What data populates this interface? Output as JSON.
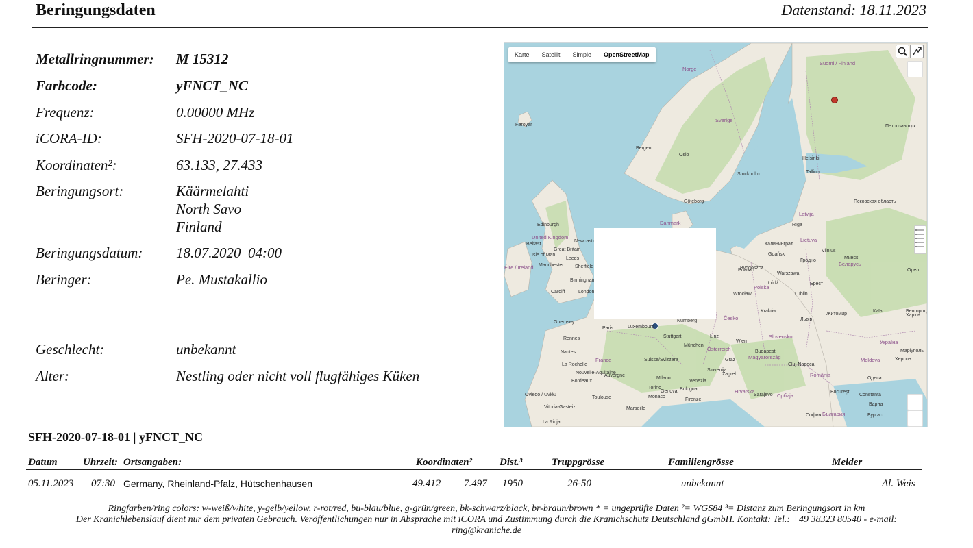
{
  "header": {
    "title": "Beringungsdaten",
    "data_date": "Datenstand: 18.11.2023"
  },
  "info": [
    {
      "label": "Metallringnummer:",
      "value": "M 15312",
      "bold": true
    },
    {
      "label": "Farbcode:",
      "value": "yFNCT_NC",
      "bold": true
    },
    {
      "label": "Frequenz:",
      "value": "0.00000 MHz"
    },
    {
      "label": "iCORA-ID:",
      "value": "SFH-2020-07-18-01"
    },
    {
      "label": "Koordinaten²:",
      "value": "63.133, 27.433"
    },
    {
      "label": "Beringungsort:",
      "value_lines": [
        "Käärmelahti",
        "North Savo",
        "Finland"
      ]
    },
    {
      "label": "Beringungsdatum:",
      "value": "18.07.2020  04:00"
    },
    {
      "label": "Beringer:",
      "value": "Pe. Mustakallio"
    },
    {
      "label": "Geschlecht:",
      "value": "unbekannt"
    },
    {
      "label": "Alter:",
      "value": "Nestling oder nicht voll flugfähiges Küken"
    }
  ],
  "map": {
    "tabs": [
      "Karte",
      "Satellit",
      "Simple",
      "OpenStreetMap"
    ],
    "active_tab": "OpenStreetMap",
    "colors": {
      "water": "#a9d3df",
      "land": "#f2efe9",
      "forest": "#c8dfb0",
      "marker_ring": "#c0392b",
      "marker_sighting": "#2c4f7c"
    },
    "labels": {
      "suomi": "Suomi / Finland",
      "norge": "Norge",
      "sverige": "Sverige",
      "bergen": "Bergen",
      "oslo": "Oslo",
      "stockholm": "Stockholm",
      "helsinki": "Helsinki",
      "tallinn": "Tallinn",
      "riga": "Rīga",
      "latvija": "Latvija",
      "lietuva": "Lietuva",
      "vilnius": "Vilnius",
      "danmark": "Danmark",
      "goteborg": "Göteborg",
      "uk": "United Kingdom",
      "great_britain": "Great Britain",
      "edinburgh": "Edinburgh",
      "belfast": "Belfast",
      "isle_of_man": "Isle of Man",
      "manchester": "Manchester",
      "leeds": "Leeds",
      "sheffield": "Sheffield",
      "birmingham": "Birmingham",
      "cardiff": "Cardiff",
      "london": "London",
      "newcastle": "Newcastle",
      "eire": "Éire / Ireland",
      "foroyar": "Føroyar",
      "guernsey": "Guernsey",
      "rennes": "Rennes",
      "paris": "Paris",
      "france": "France",
      "luxembourg": "Luxembourg",
      "nurnberg": "Nürnberg",
      "stuttgart": "Stuttgart",
      "munchen": "München",
      "schweiz": "Suisse/Svizzera",
      "osterreich": "Österreich",
      "linz": "Linz",
      "wien": "Wien",
      "graz": "Graz",
      "praha": "Česko",
      "polska": "Polska",
      "warszawa": "Warszawa",
      "poznan": "Poznań",
      "wroclaw": "Wrocław",
      "krakow": "Kraków",
      "lodz": "Łódź",
      "lublin": "Lublin",
      "gdansk": "Gdańsk",
      "bydgoszcz": "Bydgoszcz",
      "kaliningrad": "Калининград",
      "belarus": "Беларусь",
      "minsk": "Минск",
      "grodno": "Гродно",
      "brest": "Брест",
      "ukraina": "Україна",
      "kyiv": "Київ",
      "zhytomyr": "Житомир",
      "lviv": "Львів",
      "slovensko": "Slovensko",
      "magyarorszag": "Magyarország",
      "budapest": "Budapest",
      "romania": "România",
      "moldova": "Moldova",
      "cluj": "Cluj-Napoca",
      "constanta": "Constanța",
      "bucuresti": "București",
      "bulgaria": "България",
      "sofia": "София",
      "varna": "Варна",
      "burgas": "Бургас",
      "srbija": "Србија",
      "sarajevo": "Sarajevo",
      "hrvatska": "Hrvatska",
      "slovenija": "Slovenija",
      "zagreb": "Zagreb",
      "milano": "Milano",
      "torino": "Torino",
      "venezia": "Venezia",
      "bologna": "Bologna",
      "genova": "Genova",
      "monaco": "Monaco",
      "firenze": "Firenze",
      "marseille": "Marseille",
      "toulouse": "Toulouse",
      "bordeaux": "Bordeaux",
      "nantes": "Nantes",
      "la_rochelle": "La Rochelle",
      "oviedo": "Oviedo / Uviéu",
      "vitoria": "Vitoria-Gasteiz",
      "la_rioja": "La Rioja",
      "nouvelle": "Nouvelle-Aquitaine",
      "auvergne": "Auvergne",
      "petrozavodsk": "Петрозаводск",
      "pskov": "Псковская область",
      "kharkiv": "Харків",
      "odesa": "Одеса",
      "kherson": "Херсон",
      "mariupol": "Маріуполь",
      "orel": "Орел",
      "belgorod": "Белгород"
    }
  },
  "sightings": {
    "title": "SFH-2020-07-18-01 | yFNCT_NC",
    "columns": {
      "datum": "Datum",
      "uhrzeit": "Uhrzeit:",
      "ortsangaben": "Ortsangaben:",
      "koordinaten": "Koordinaten²",
      "dist": "Dist.³",
      "trupp": "Truppgrösse",
      "familie": "Familiengrösse",
      "melder": "Melder"
    },
    "rows": [
      {
        "datum": "05.11.2023",
        "uhrzeit": "07:30",
        "ort": "Germany, Rheinland-Pfalz, Hütschenhausen",
        "lat": "49.412",
        "lon": "7.497",
        "dist": "1950",
        "trupp": "26-50",
        "familie": "unbekannt",
        "melder": "Al. Weis"
      }
    ]
  },
  "footer": {
    "line1": "Ringfarben/ring colors: w-weiß/white, y-gelb/yellow, r-rot/red, bu-blau/blue, g-grün/green, bk-schwarz/black, br-braun/brown * = ungeprüfte Daten  ²= WGS84  ³= Distanz zum Beringungsort in km",
    "line2": "Der Kranichlebenslauf dient nur dem privaten Gebrauch. Veröffentlichungen nur in Absprache mit iCORA und Zustimmung durch die Kranichschutz Deutschland gGmbH. Kontakt: Tel.: +49 38323 80540 - e-mail:",
    "line3": "ring@kraniche.de"
  }
}
